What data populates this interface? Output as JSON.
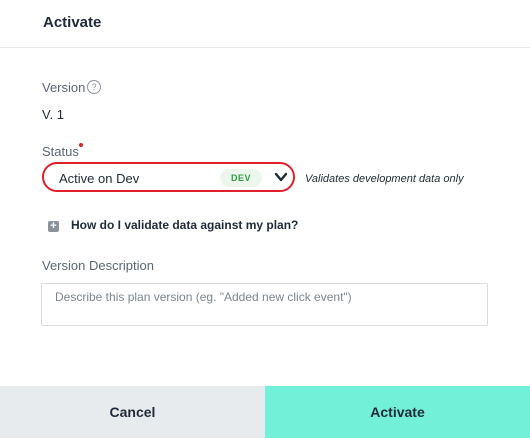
{
  "header": {
    "title": "Activate"
  },
  "version": {
    "label": "Version",
    "help_icon": "question-circle-icon",
    "value": "V. 1"
  },
  "status": {
    "label": "Status",
    "required_color": "#e0202b",
    "selected": "Active on Dev",
    "badge": "DEV",
    "hint": "Validates development data only",
    "chevron_icon": "chevron-down-icon"
  },
  "help_link": {
    "icon": "plus-square-icon",
    "label": "How do I validate data against my plan?"
  },
  "description": {
    "label": "Version Description",
    "value": "",
    "placeholder": "Describe this plan version (eg. \"Added new click event\")"
  },
  "footer": {
    "cancel_label": "Cancel",
    "activate_label": "Activate"
  },
  "colors": {
    "accent": "#72f0d8",
    "error": "#e0202b",
    "badge_text": "#2f9e44",
    "badge_bg": "#ecf6ec"
  }
}
